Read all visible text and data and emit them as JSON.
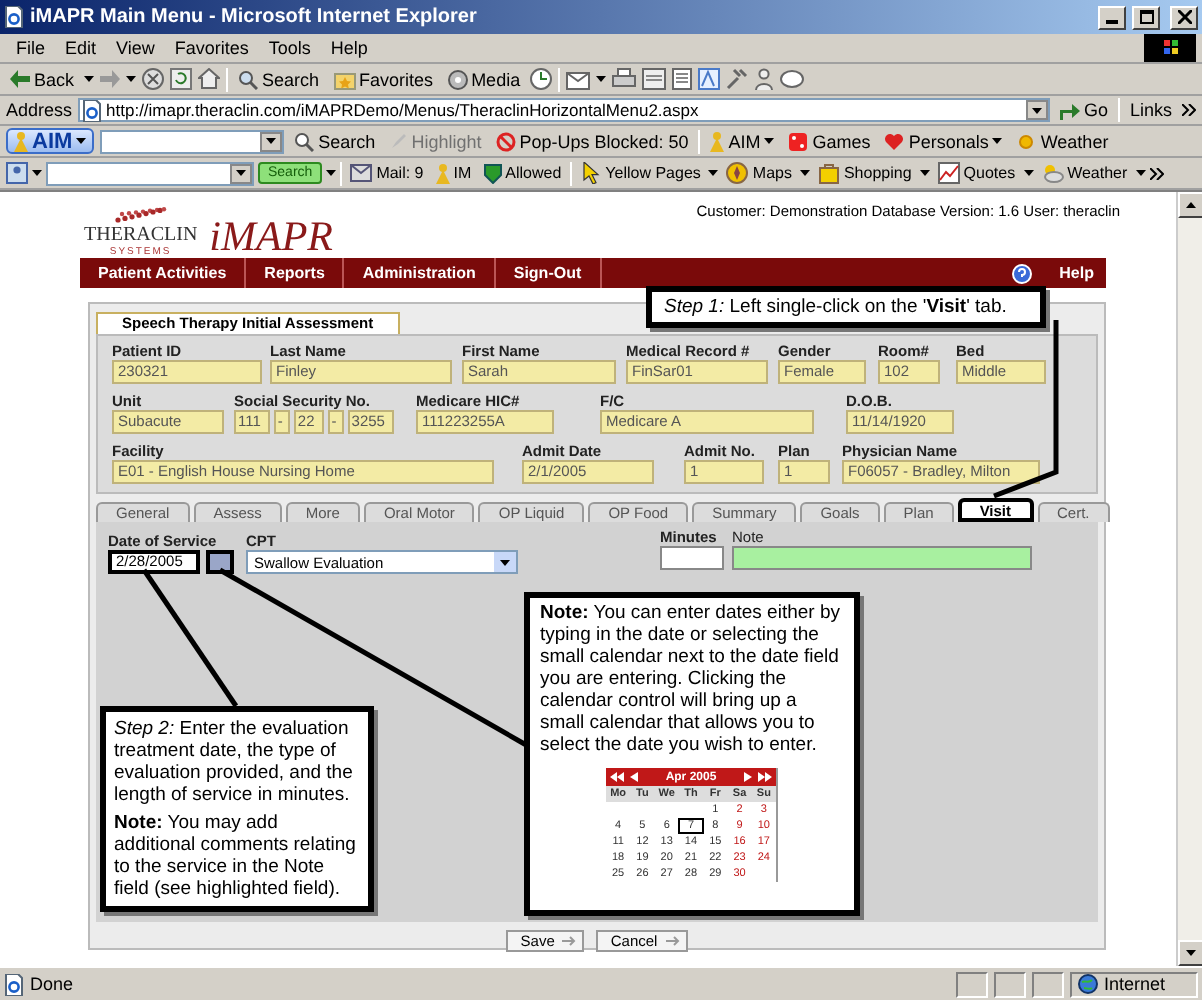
{
  "window": {
    "title": "iMAPR Main Menu - Microsoft Internet Explorer"
  },
  "menu": [
    "File",
    "Edit",
    "View",
    "Favorites",
    "Tools",
    "Help"
  ],
  "toolbar": {
    "back": "Back",
    "search": "Search",
    "favorites": "Favorites",
    "media": "Media"
  },
  "address_bar": {
    "label": "Address",
    "url": "http://imapr.theraclin.com/iMAPRDemo/Menus/TheraclinHorizontalMenu2.aspx",
    "go": "Go",
    "links": "Links"
  },
  "aim_toolbar": {
    "aim": "AIM",
    "search": "Search",
    "highlight": {
      "label": "Highlight",
      "disabled": true
    },
    "popups": "Pop-Ups Blocked: 50",
    "aim_menu": "AIM",
    "games": "Games",
    "personals": "Personals",
    "weather": "Weather"
  },
  "search_toolbar": {
    "search": "Search",
    "mail": "Mail: 9",
    "im": "IM",
    "allowed": "Allowed",
    "yellow_pages": "Yellow Pages",
    "maps": "Maps",
    "shopping": "Shopping",
    "quotes": "Quotes",
    "weather": "Weather"
  },
  "header": {
    "brand": "THERACLIN",
    "brand_sub": "SYSTEMS",
    "product": "iMAPR",
    "info": "Customer: Demonstration Database Version: 1.6 User: theraclin"
  },
  "nav": {
    "items": [
      "Patient Activities",
      "Reports",
      "Administration",
      "Sign-Out"
    ],
    "help": "Help"
  },
  "form": {
    "title": "Speech Therapy Initial Assessment",
    "rows": [
      [
        {
          "label": "Patient ID",
          "value": "230321"
        },
        {
          "label": "Last Name",
          "value": "Finley"
        },
        {
          "label": "First Name",
          "value": "Sarah"
        },
        {
          "label": "Medical Record #",
          "value": "FinSar01"
        },
        {
          "label": "Gender",
          "value": "Female"
        },
        {
          "label": "Room#",
          "value": "102"
        },
        {
          "label": "Bed",
          "value": "Middle"
        }
      ],
      [
        {
          "label": "Unit",
          "value": "Subacute"
        },
        {
          "label": "Social Security No.",
          "parts": [
            "111",
            "-",
            "22",
            "-",
            "3255"
          ]
        },
        {
          "label": "Medicare HIC#",
          "value": "111223255A"
        },
        {
          "label": "F/C",
          "value": "Medicare A"
        },
        {
          "label": "D.O.B.",
          "value": "11/14/1920"
        }
      ],
      [
        {
          "label": "Facility",
          "value": "E01 - English House Nursing Home"
        },
        {
          "label": "Admit Date",
          "value": "2/1/2005"
        },
        {
          "label": "Admit No.",
          "value": "1"
        },
        {
          "label": "Plan",
          "value": "1"
        },
        {
          "label": "Physician Name",
          "value": "F06057 - Bradley, Milton"
        }
      ]
    ]
  },
  "subtabs": [
    {
      "label": "General",
      "selected": false
    },
    {
      "label": "Assess",
      "selected": false
    },
    {
      "label": "More",
      "selected": false
    },
    {
      "label": "Oral Motor",
      "selected": false
    },
    {
      "label": "OP Liquid",
      "selected": false
    },
    {
      "label": "OP Food",
      "selected": false
    },
    {
      "label": "Summary",
      "selected": false
    },
    {
      "label": "Goals",
      "selected": false
    },
    {
      "label": "Plan",
      "selected": false
    },
    {
      "label": "Visit",
      "selected": true
    },
    {
      "label": "Cert.",
      "selected": false
    }
  ],
  "visit": {
    "date_label": "Date of Service",
    "date": "2/28/2005",
    "cpt_label": "CPT",
    "cpt": "Swallow Evaluation",
    "minutes_label": "Minutes",
    "note_label": "Note",
    "note_highlighted": true
  },
  "buttons": [
    "Save",
    "Cancel"
  ],
  "callouts": {
    "step1": "*Step 1:* Left single-click on the '**Visit**' tab.",
    "step2": [
      "*Step 2:* Enter the evaluation treatment date, the type of evaluation provided, and the length of service in minutes.",
      "**Note:** You may add additional comments relating to the service in the Note field (see highlighted field)."
    ],
    "note": {
      "text": "**Note:** You can enter dates either by typing in the date or selecting the small calendar next to the date field you are entering. Clicking the calendar control will bring up a small calendar that allows you to select the date you wish to enter.",
      "calendar": {
        "month": "Apr 2005",
        "weekdays": [
          "Mo",
          "Tu",
          "We",
          "Th",
          "Fr",
          "Sa",
          "Su"
        ],
        "weeks": [
          [
            {
              "d": "1",
              "selected": false
            },
            {
              "d": "2",
              "selected": false
            },
            {
              "d": "3",
              "selected": false
            }
          ],
          [
            {
              "d": "4",
              "selected": false
            },
            {
              "d": "5",
              "selected": false
            },
            {
              "d": "6",
              "selected": false
            },
            {
              "d": "7",
              "selected": true
            },
            {
              "d": "8",
              "selected": false
            },
            {
              "d": "9",
              "selected": false
            },
            {
              "d": "10",
              "selected": false
            }
          ],
          [
            {
              "d": "11",
              "selected": false
            },
            {
              "d": "12",
              "selected": false
            },
            {
              "d": "13",
              "selected": false
            },
            {
              "d": "14",
              "selected": false
            },
            {
              "d": "15",
              "selected": false
            },
            {
              "d": "16",
              "selected": false
            },
            {
              "d": "17",
              "selected": false
            }
          ],
          [
            {
              "d": "18",
              "selected": false
            },
            {
              "d": "19",
              "selected": false
            },
            {
              "d": "20",
              "selected": false
            },
            {
              "d": "21",
              "selected": false
            },
            {
              "d": "22",
              "selected": false
            },
            {
              "d": "23",
              "selected": false
            },
            {
              "d": "24",
              "selected": false
            }
          ],
          [
            {
              "d": "25",
              "selected": false
            },
            {
              "d": "26",
              "selected": false
            },
            {
              "d": "27",
              "selected": false
            },
            {
              "d": "28",
              "selected": false
            },
            {
              "d": "29",
              "selected": false
            },
            {
              "d": "30",
              "selected": false
            }
          ]
        ]
      }
    }
  },
  "status_bar": {
    "text": "Done",
    "zone": "Internet"
  }
}
